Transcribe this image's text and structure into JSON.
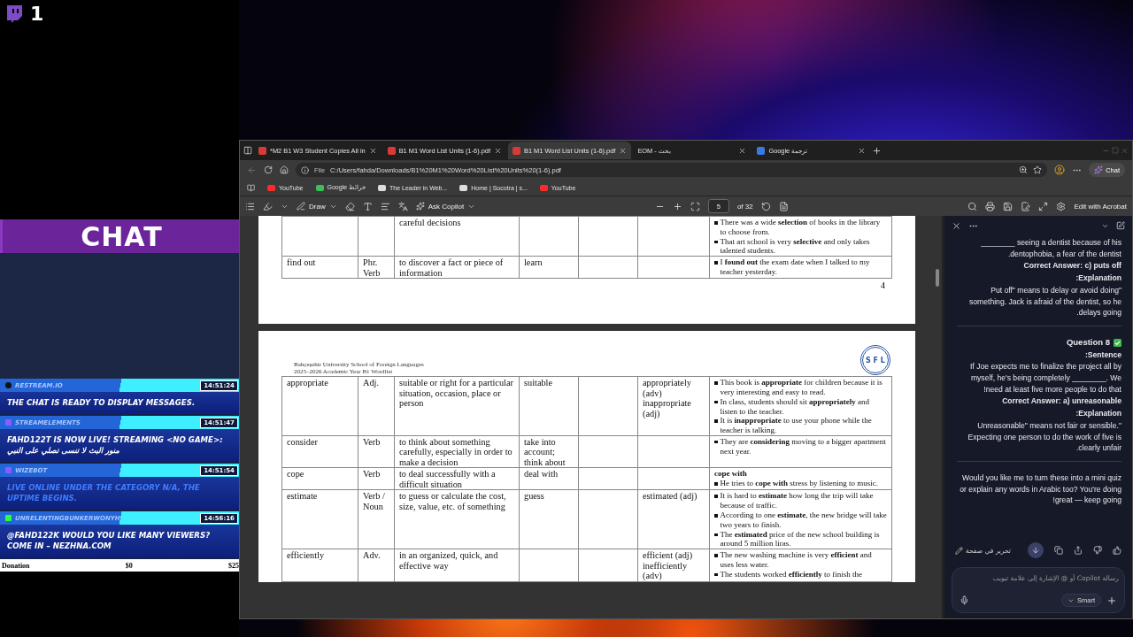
{
  "stream_badge": {
    "count": "1"
  },
  "chat_overlay": {
    "title": "CHAT",
    "messages": [
      {
        "kind": "restream",
        "user": "RESTREAM.IO",
        "time": "14:51:24",
        "text": "THE CHAT IS READY TO DISPLAY MESSAGES."
      },
      {
        "kind": "streamelements",
        "user": "STREAMELEMENTS",
        "time": "14:51:47",
        "text": "FAHD122T IS NOW LIVE! STREAMING <NO GAME>: منور البث لا تنسى تصلي على النبي"
      },
      {
        "kind": "wizebot",
        "user": "WIZEBOT",
        "time": "14:51:54",
        "text": "LIVE ONLINE UNDER THE CATEGORY N/A, THE UPTIME BEGINS."
      },
      {
        "kind": "kick",
        "user": "UNRELENTINGBUNKERWONYH",
        "time": "14:56:16",
        "text": "@FAHD122K WOULD YOU LIKE MANY VIEWERS? COME IN – NEZHNA.COM"
      }
    ],
    "donation": {
      "label": "Donation",
      "current": "$0",
      "goal": "$25"
    }
  },
  "browser": {
    "tabs": [
      {
        "kind": "pdf",
        "title": "*M2 B1 W3 Student Copies All in",
        "selected": false
      },
      {
        "kind": "pdf",
        "title": "B1 M1 Word List Units (1-6).pdf",
        "selected": false
      },
      {
        "kind": "pdf",
        "title": "B1 M1 Word List Units (1-6).pdf",
        "selected": true
      },
      {
        "kind": "plain",
        "title": "EOM - بحث",
        "selected": false
      },
      {
        "kind": "translate",
        "title": "Google ترجمة",
        "selected": false
      }
    ],
    "address": {
      "scheme": "File",
      "url": "C:/Users/fahda/Downloads/B1%20M1%20Word%20List%20Units%20(1-6).pdf"
    },
    "chat_button": "Chat",
    "bookmarks": [
      {
        "kind": "video",
        "label": "YouTube"
      },
      {
        "kind": "maps",
        "label": "Google خرائط"
      },
      {
        "kind": "web",
        "label": "The Leader in Web..."
      },
      {
        "kind": "web",
        "label": "Home | Socotra | s..."
      },
      {
        "kind": "video",
        "label": "YouTube"
      }
    ]
  },
  "pdf_toolbar": {
    "draw": "Draw",
    "ask": "Ask Copilot",
    "page": "5",
    "page_count": "of 32",
    "edit": "Edit with Acrobat"
  },
  "pdf_pages": [
    {
      "rows": [
        {
          "definition": "careful decisions",
          "examples": [
            {
              "kind": "bullet",
              "text": "There was a wide **selection** of books in the library to choose from."
            },
            {
              "kind": "bullet",
              "text": "That art school is very **selective** and only takes talented students."
            }
          ]
        },
        {
          "word": "find out",
          "type": "Phr. Verb",
          "definition": "to discover a fact or piece of information",
          "synonym": "learn",
          "examples": [
            {
              "kind": "bullet",
              "text": "I **found out** the exam date when I talked to my teacher yesterday."
            }
          ]
        }
      ],
      "page_number": "4"
    },
    {
      "header": [
        "Bahçeşehir University School of Foreign Languages",
        "2025–2026 Academic Year B1 Wordlist"
      ],
      "logo": "S F L",
      "rows": [
        {
          "word": "appropriate",
          "type": "Adj.",
          "definition": "suitable or right for a particular situation, occasion, place or person",
          "synonym": "suitable",
          "forms": "appropriately (adv) inappropriate (adj)",
          "examples": [
            {
              "kind": "bullet",
              "text": "This book is **appropriate** for children because it is very interesting and easy to read."
            },
            {
              "kind": "bullet",
              "text": "In class, students should sit **appropriately** and listen to the teacher."
            },
            {
              "kind": "bullet",
              "text": "It is **inappropriate** to use your phone while the teacher is talking."
            }
          ]
        },
        {
          "word": "consider",
          "type": "Verb",
          "definition": "to think about something carefully, especially in order to make a decision",
          "synonym": "take into account; think about",
          "examples": [
            {
              "kind": "bullet",
              "text": "They are **considering** moving to a bigger apartment next year."
            }
          ]
        },
        {
          "word": "cope",
          "type": "Verb",
          "definition": "to deal successfully with a difficult situation",
          "synonym": "deal with",
          "examples": [
            {
              "kind": "heading",
              "text": "cope with"
            },
            {
              "kind": "bullet",
              "text": "He tries to **cope with** stress by listening to music."
            }
          ]
        },
        {
          "word": "estimate",
          "type": "Verb / Noun",
          "definition": "to guess or calculate the cost, size, value, etc. of something",
          "synonym": "guess",
          "forms": "estimated (adj)",
          "examples": [
            {
              "kind": "bullet",
              "text": "It is hard to **estimate** how long the trip will take because of traffic."
            },
            {
              "kind": "bullet",
              "text": "According to one **estimate**, the new bridge will take two years to finish."
            },
            {
              "kind": "bullet",
              "text": "The **estimated** price of the new school building is around 5 million liras."
            }
          ]
        },
        {
          "word": "efficiently",
          "type": "Adv.",
          "definition": "in an organized, quick, and effective way",
          "forms": "efficient (adj) inefficiently (adv)",
          "examples": [
            {
              "kind": "bullet",
              "text": "The new washing machine is very **efficient** and uses less water."
            },
            {
              "kind": "bullet",
              "text": "The students worked **efficiently** to finish the"
            }
          ]
        }
      ]
    }
  ],
  "copilot": {
    "sections": [
      [
        {
          "kind": "paragraph",
          "text": "________ seeing a dentist because of his .dentophobia, a fear of the dentist"
        },
        {
          "kind": "bold",
          "text": "Correct Answer: c) puts off"
        },
        {
          "kind": "bold",
          "text": ":Explanation"
        },
        {
          "kind": "paragraph",
          "text": "Put off\" means to delay or avoid doing\" something. Jack is afraid of the dentist, so he .delays going"
        }
      ],
      [
        {
          "kind": "question",
          "text": "Question 8"
        },
        {
          "kind": "bold",
          "text": ":Sentence"
        },
        {
          "kind": "paragraph",
          "text": "If Joe expects me to finalize the project all by myself, he's being completely ________. We !need at least five more people to do that"
        },
        {
          "kind": "bold",
          "text": "Correct Answer: a) unreasonable"
        },
        {
          "kind": "bold",
          "text": ":Explanation"
        },
        {
          "kind": "paragraph",
          "text": "Unreasonable\" means not fair or sensible.\" Expecting one person to do the work of five is .clearly unfair"
        }
      ],
      [
        {
          "kind": "paragraph",
          "text": "Would you like me to turn these into a mini quiz or explain any words in Arabic too? You're doing !great — keep going"
        }
      ]
    ],
    "edit_in_page": "تحرير في صفحة",
    "input_placeholder": "رسالة Copilot أو @ الإشارة إلى علامة تبويب",
    "mode": "Smart"
  }
}
